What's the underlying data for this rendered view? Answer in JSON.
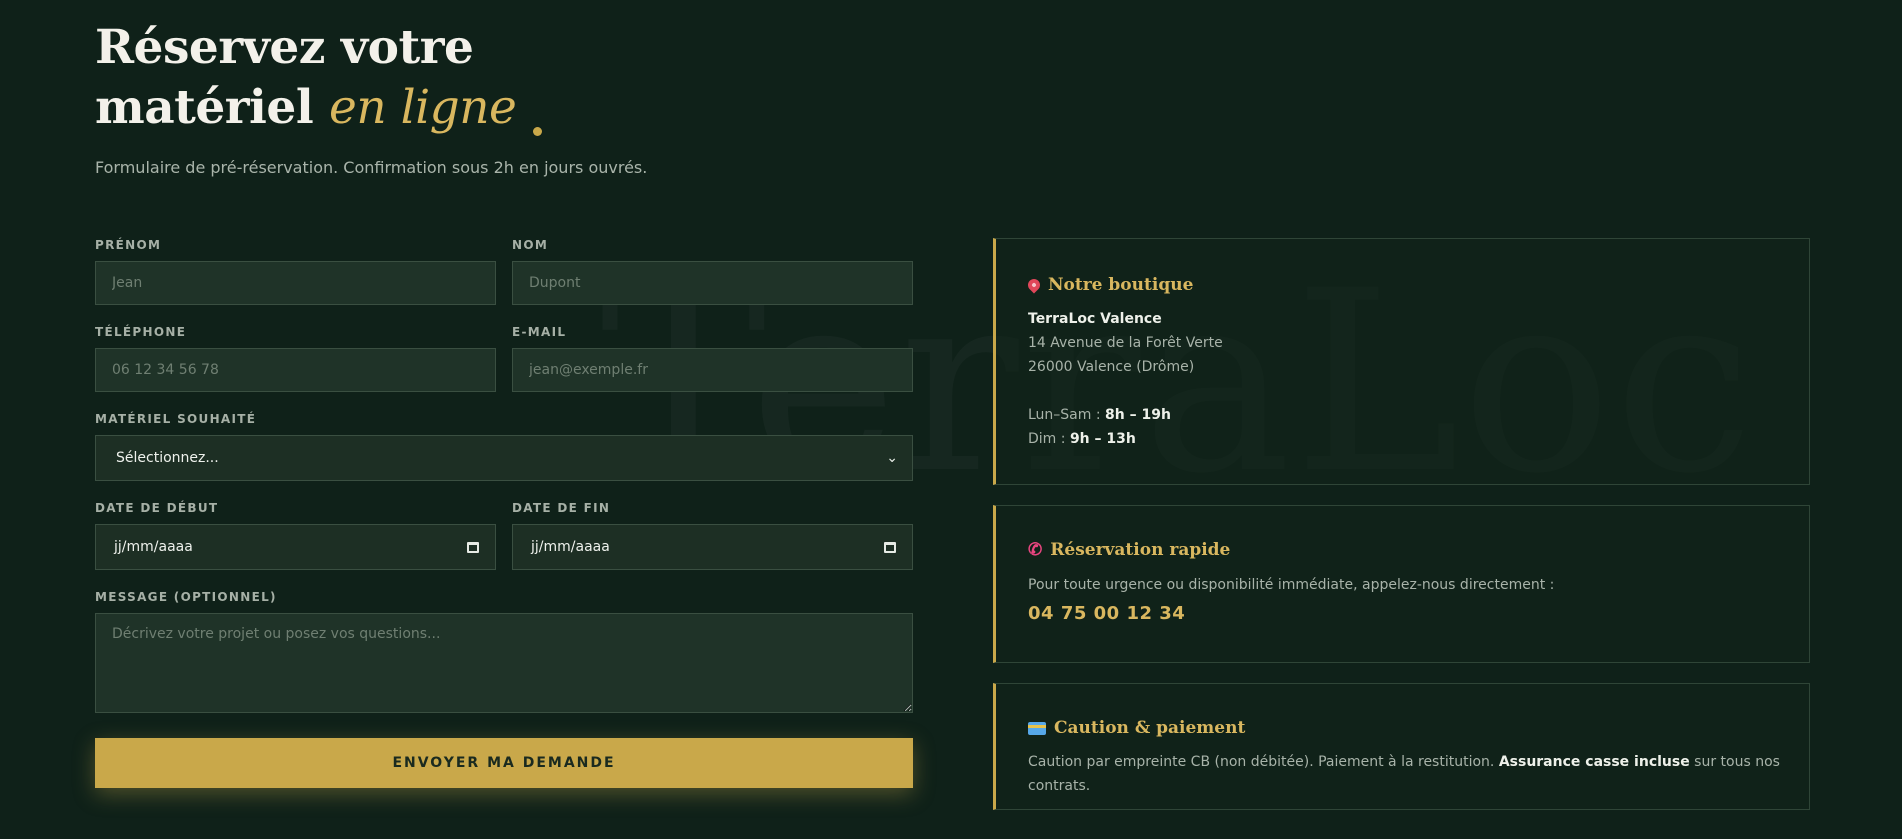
{
  "hero": {
    "title_line1": "Réservez votre",
    "title_line2_plain": "matériel ",
    "title_line2_accent": "en ligne",
    "subtitle": "Formulaire de pré-réservation. Confirmation sous 2h en jours ouvrés."
  },
  "watermark": "TerraLoc",
  "form": {
    "firstname": {
      "label": "PRÉNOM",
      "placeholder": "Jean"
    },
    "lastname": {
      "label": "NOM",
      "placeholder": "Dupont"
    },
    "phone": {
      "label": "TÉLÉPHONE",
      "placeholder": "06 12 34 56 78"
    },
    "email": {
      "label": "E-MAIL",
      "placeholder": "jean@exemple.fr"
    },
    "equipment": {
      "label": "MATÉRIEL SOUHAITÉ",
      "selected": "Sélectionnez..."
    },
    "start_date": {
      "label": "DATE DE DÉBUT",
      "value": "jj/mm/aaaa"
    },
    "end_date": {
      "label": "DATE DE FIN",
      "value": "jj/mm/aaaa"
    },
    "message": {
      "label": "MESSAGE (OPTIONNEL)",
      "placeholder": "Décrivez votre projet ou posez vos questions..."
    },
    "submit_label": "ENVOYER MA DEMANDE"
  },
  "shop": {
    "title": "Notre boutique",
    "icon": "pin-icon",
    "name": "TerraLoc Valence",
    "address1": "14 Avenue de la Forêt Verte",
    "address2": "26000 Valence (Drôme)",
    "weekday_label": "Lun–Sam : ",
    "weekday_hours": "8h – 19h",
    "sunday_label": "Dim : ",
    "sunday_hours": "9h – 13h"
  },
  "quick": {
    "title": "Réservation rapide",
    "icon": "phone-icon",
    "text": "Pour toute urgence ou disponibilité immédiate, appelez-nous directement :",
    "phone": "04 75 00 12 34"
  },
  "payment": {
    "title": "Caution & paiement",
    "icon": "credit-card-icon",
    "text_before": "Caution par empreinte CB (non débitée). Paiement à la restitution. ",
    "text_strong": "Assurance casse incluse",
    "text_after": " sur tous nos contrats."
  },
  "colors": {
    "background": "#0f2119",
    "accent": "#c9a84a",
    "accent_text": "#d9b75f"
  }
}
